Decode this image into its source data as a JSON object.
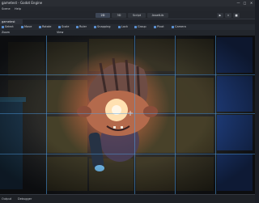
{
  "window": {
    "title": "gametest - Godot Engine",
    "controls": [
      "—",
      "□",
      "✕"
    ]
  },
  "menu": {
    "items": [
      "Scene",
      "Help"
    ]
  },
  "main_screens": [
    {
      "label": "2D",
      "active": true
    },
    {
      "label": "3D",
      "active": false
    },
    {
      "label": "Script",
      "active": false
    },
    {
      "label": "AssetLib",
      "active": false
    }
  ],
  "play_controls": [
    "▶",
    "⏸",
    "■"
  ],
  "scene_tab": {
    "label": "gametest"
  },
  "toolbar": {
    "items": [
      "Select",
      "Move",
      "Rotate",
      "Scale",
      "Ruler",
      "Snapping",
      "Lock",
      "Group",
      "Pivot",
      "Camera"
    ],
    "sub_items": [
      "Zoom",
      "View"
    ]
  },
  "status_bar": {
    "items": [
      "Output",
      "Debugger"
    ]
  },
  "colors": {
    "accent": "#5a8fd0",
    "grid": "#50a0e6",
    "tile_yellow": "#4a4428",
    "tile_blue": "#1e3f7a"
  }
}
